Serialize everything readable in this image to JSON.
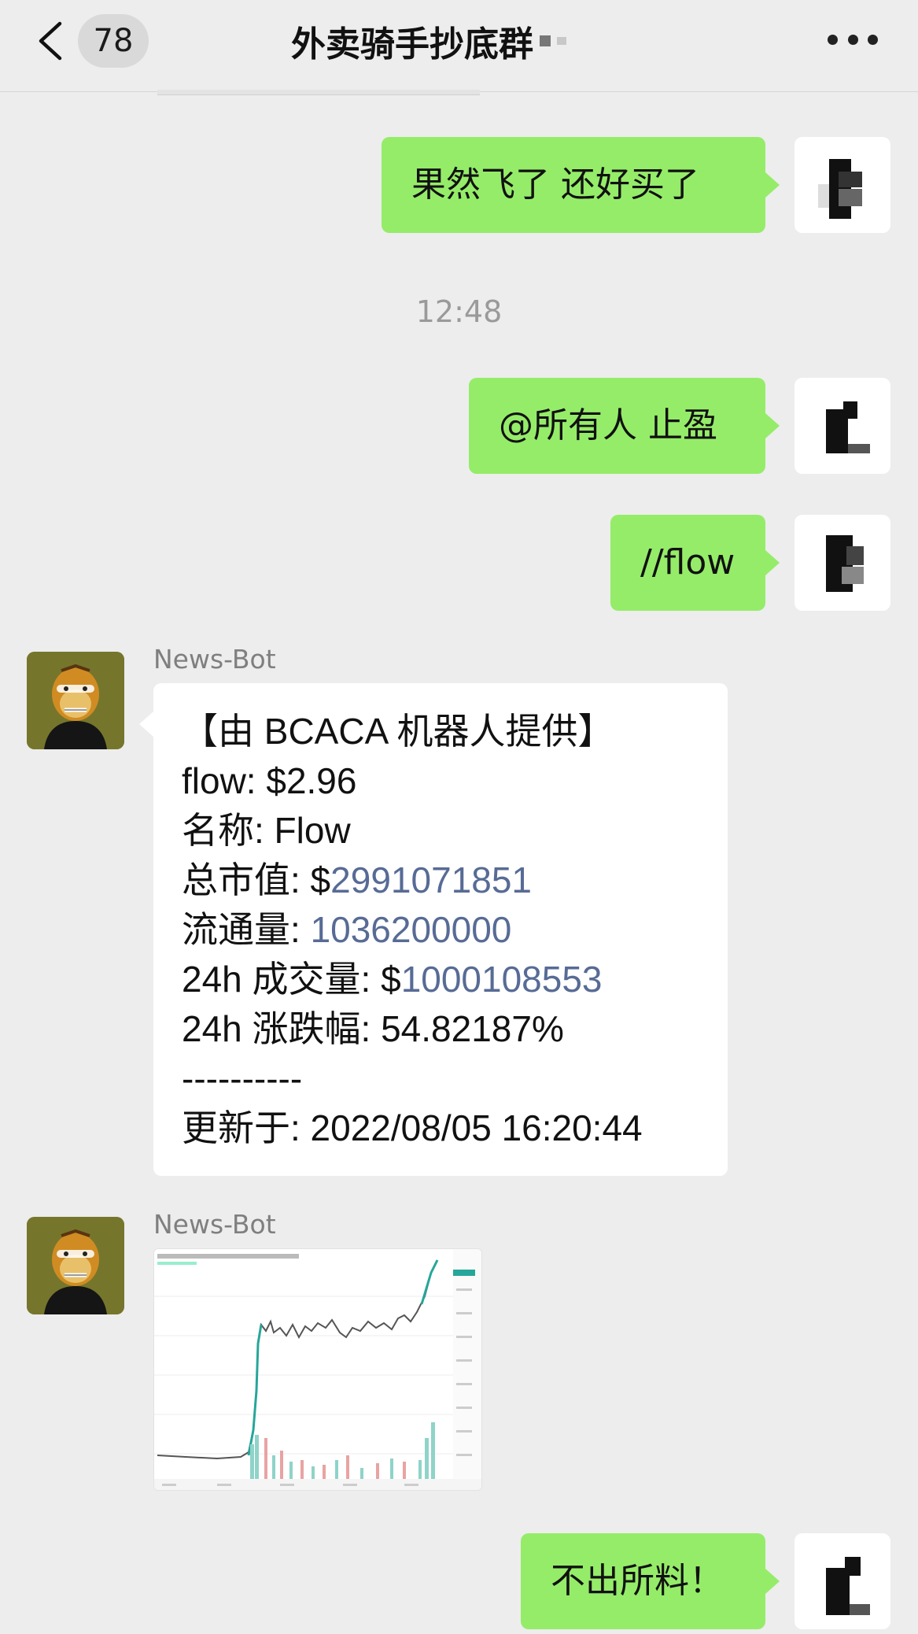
{
  "header": {
    "back_count": "78",
    "title": "外卖骑手抄底群"
  },
  "messages": {
    "m1": "果然飞了 还好买了",
    "time": "12:48",
    "m2": "@所有人 止盈",
    "m3": "//flow",
    "bot_name": "News-Bot",
    "card": {
      "l1": "【由 BCACA 机器人提供】",
      "l2": "flow: $2.96",
      "l3": "名称: Flow",
      "l4_label": "总市值: $",
      "l4_value": "2991071851",
      "l5_label": "流通量: ",
      "l5_value": "1036200000",
      "l6_label": "24h 成交量: $",
      "l6_value": "1000108553",
      "l7": "24h 涨跌幅: 54.82187%",
      "l8": "----------",
      "l9": "更新于: 2022/08/05 16:20:44"
    },
    "m4": "不出所料！"
  },
  "colors": {
    "background": "#ededed",
    "bubble_self": "#95ec69",
    "bubble_other": "#ffffff",
    "link": "#576b95"
  }
}
